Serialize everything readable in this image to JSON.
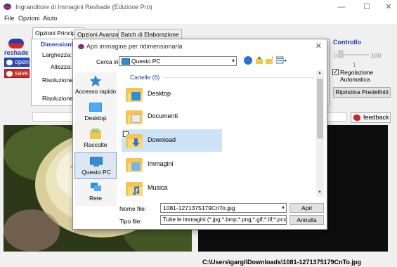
{
  "window": {
    "title": "Ingranditore di Immagini Reshade (Edizione Pro)",
    "controls": [
      "—",
      "☐",
      "✕"
    ]
  },
  "menu": [
    "File",
    "Opzioni",
    "Aiuto"
  ],
  "toolbar": {
    "logo_text": "reshade",
    "open_label": "open",
    "save_label": "save"
  },
  "tabs": [
    "Opzioni Principali",
    "Opzioni Avanzate",
    "Batch di Elaborazione"
  ],
  "main_panel": {
    "group_title": "Dimensioni i",
    "width_label": "Larghezza:",
    "height_label": "Altezza:",
    "resolution_label": "Risoluzione",
    "resolution2_label": "Risoluzione de"
  },
  "control_panel": {
    "title": "Controllo",
    "slider_min": "0",
    "slider_max": "100",
    "slider_value": "1",
    "auto_adjust_label": "Regolazione Automatica",
    "auto_adjust_checked": true,
    "reset_button": "Ripristina Predefiniti"
  },
  "feedback_label": "feedback",
  "status_path": "C:\\Users\\gargi\\Downloads\\1081-1271375179CnTo.jpg",
  "dialog": {
    "title": "Apri immagine per ridimensionarla",
    "close": "✕",
    "look_in_label": "Cerca in:",
    "look_in_value": "Questo PC",
    "places": [
      {
        "label": "Accesso rapido",
        "icon": "star-icon"
      },
      {
        "label": "Desktop",
        "icon": "desktop-icon"
      },
      {
        "label": "Raccolte",
        "icon": "libraries-icon"
      },
      {
        "label": "Questo PC",
        "icon": "pc-icon"
      },
      {
        "label": "Rete",
        "icon": "network-icon"
      }
    ],
    "group_header": "Cartelle (6)",
    "folders": [
      {
        "name": "Desktop",
        "badge": "#2e8fd8"
      },
      {
        "name": "Documenti",
        "badge": "#e9e9e9"
      },
      {
        "name": "Download",
        "badge": "#3a8fdc"
      },
      {
        "name": "Immagini",
        "badge": "#7cb3e0"
      },
      {
        "name": "Musica",
        "badge": "#3a8fdc"
      }
    ],
    "selected_folder": "Download",
    "filename_label": "Nome file:",
    "filename_value": "1081-1271375179CnTo.jpg",
    "filetype_label": "Tipo file:",
    "filetype_value": "Tutte le immagini (*.jpg;*.bmp;*.png;*.gif;*.tif;*.pcx;*.pr",
    "open_button": "Apri",
    "cancel_button": "Annulla"
  }
}
